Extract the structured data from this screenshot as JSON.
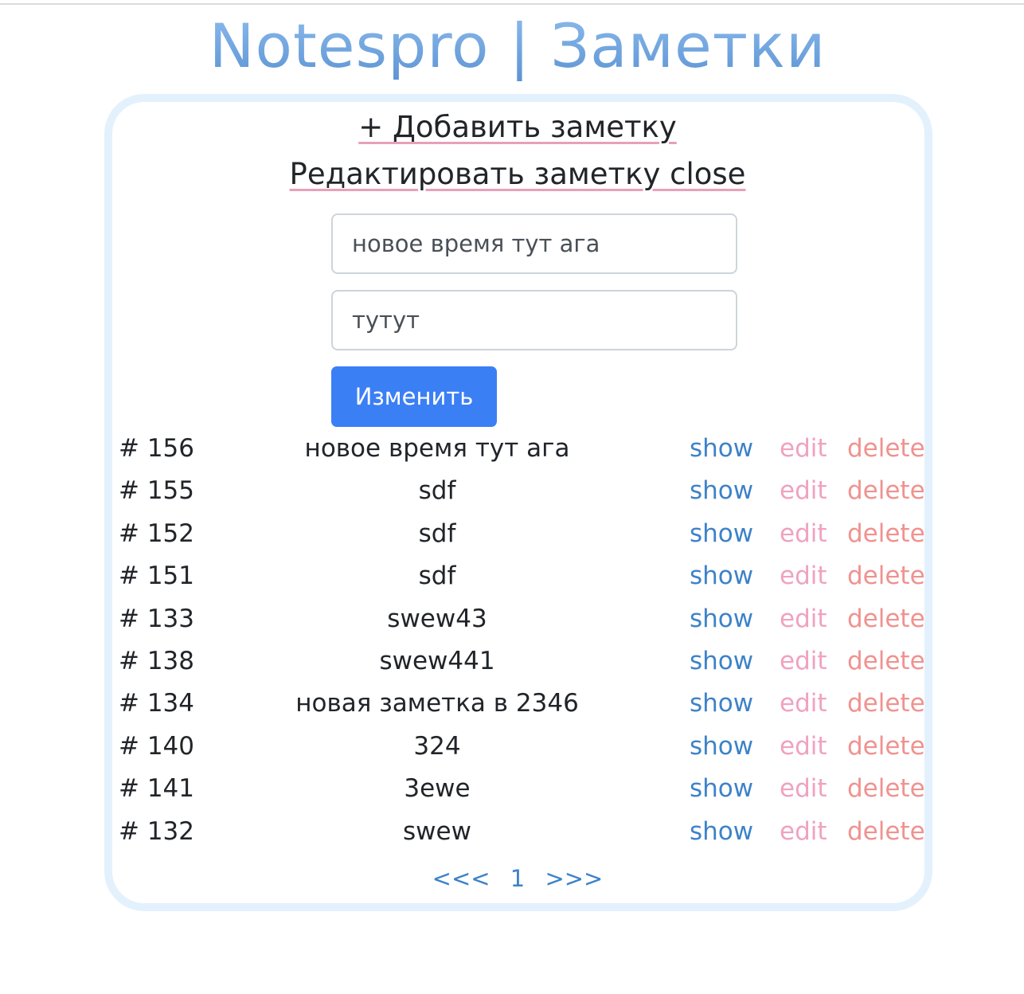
{
  "app": {
    "title": "Notespro | Заметки"
  },
  "header": {
    "add_label": "+ Добавить заметку",
    "edit_label": "Редактировать заметку close"
  },
  "form": {
    "title_value": "новое время тут ага",
    "body_value": "тутут",
    "submit_label": "Изменить"
  },
  "colors": {
    "title": "#6fa3dc",
    "show": "#3d82c8",
    "edit": "#f0a2c0",
    "delete": "#f0928f",
    "button": "#3b7ff5",
    "card_border": "#e3f1fd"
  },
  "actions": {
    "show": "show",
    "edit": "edit",
    "delete": "delete"
  },
  "notes": [
    {
      "id": "# 156",
      "title": "новое время тут ага"
    },
    {
      "id": "# 155",
      "title": "sdf"
    },
    {
      "id": "# 152",
      "title": "sdf"
    },
    {
      "id": "# 151",
      "title": "sdf"
    },
    {
      "id": "# 133",
      "title": "swew43"
    },
    {
      "id": "# 138",
      "title": "swew441"
    },
    {
      "id": "# 134",
      "title": "новая заметка в 2346"
    },
    {
      "id": "# 140",
      "title": "324"
    },
    {
      "id": "# 141",
      "title": "3ewe"
    },
    {
      "id": "# 132",
      "title": "swew"
    }
  ],
  "pagination": {
    "prev": "<<<",
    "current": "1",
    "next": ">>>"
  }
}
